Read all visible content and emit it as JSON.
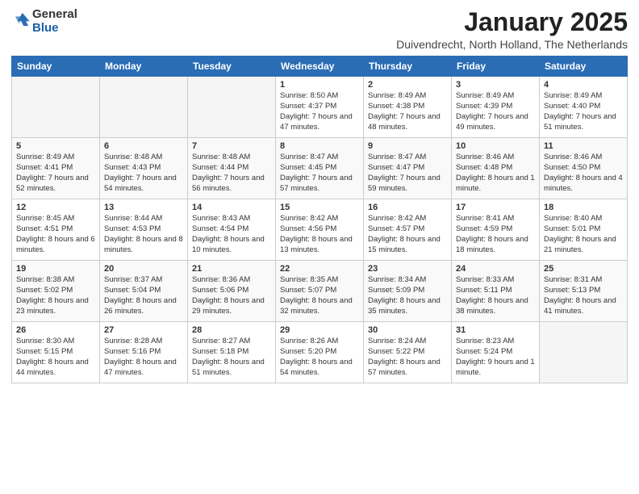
{
  "header": {
    "logo_general": "General",
    "logo_blue": "Blue",
    "month_title": "January 2025",
    "location": "Duivendrecht, North Holland, The Netherlands"
  },
  "weekdays": [
    "Sunday",
    "Monday",
    "Tuesday",
    "Wednesday",
    "Thursday",
    "Friday",
    "Saturday"
  ],
  "weeks": [
    [
      {
        "day": "",
        "info": ""
      },
      {
        "day": "",
        "info": ""
      },
      {
        "day": "",
        "info": ""
      },
      {
        "day": "1",
        "info": "Sunrise: 8:50 AM\nSunset: 4:37 PM\nDaylight: 7 hours and 47 minutes."
      },
      {
        "day": "2",
        "info": "Sunrise: 8:49 AM\nSunset: 4:38 PM\nDaylight: 7 hours and 48 minutes."
      },
      {
        "day": "3",
        "info": "Sunrise: 8:49 AM\nSunset: 4:39 PM\nDaylight: 7 hours and 49 minutes."
      },
      {
        "day": "4",
        "info": "Sunrise: 8:49 AM\nSunset: 4:40 PM\nDaylight: 7 hours and 51 minutes."
      }
    ],
    [
      {
        "day": "5",
        "info": "Sunrise: 8:49 AM\nSunset: 4:41 PM\nDaylight: 7 hours and 52 minutes."
      },
      {
        "day": "6",
        "info": "Sunrise: 8:48 AM\nSunset: 4:43 PM\nDaylight: 7 hours and 54 minutes."
      },
      {
        "day": "7",
        "info": "Sunrise: 8:48 AM\nSunset: 4:44 PM\nDaylight: 7 hours and 56 minutes."
      },
      {
        "day": "8",
        "info": "Sunrise: 8:47 AM\nSunset: 4:45 PM\nDaylight: 7 hours and 57 minutes."
      },
      {
        "day": "9",
        "info": "Sunrise: 8:47 AM\nSunset: 4:47 PM\nDaylight: 7 hours and 59 minutes."
      },
      {
        "day": "10",
        "info": "Sunrise: 8:46 AM\nSunset: 4:48 PM\nDaylight: 8 hours and 1 minute."
      },
      {
        "day": "11",
        "info": "Sunrise: 8:46 AM\nSunset: 4:50 PM\nDaylight: 8 hours and 4 minutes."
      }
    ],
    [
      {
        "day": "12",
        "info": "Sunrise: 8:45 AM\nSunset: 4:51 PM\nDaylight: 8 hours and 6 minutes."
      },
      {
        "day": "13",
        "info": "Sunrise: 8:44 AM\nSunset: 4:53 PM\nDaylight: 8 hours and 8 minutes."
      },
      {
        "day": "14",
        "info": "Sunrise: 8:43 AM\nSunset: 4:54 PM\nDaylight: 8 hours and 10 minutes."
      },
      {
        "day": "15",
        "info": "Sunrise: 8:42 AM\nSunset: 4:56 PM\nDaylight: 8 hours and 13 minutes."
      },
      {
        "day": "16",
        "info": "Sunrise: 8:42 AM\nSunset: 4:57 PM\nDaylight: 8 hours and 15 minutes."
      },
      {
        "day": "17",
        "info": "Sunrise: 8:41 AM\nSunset: 4:59 PM\nDaylight: 8 hours and 18 minutes."
      },
      {
        "day": "18",
        "info": "Sunrise: 8:40 AM\nSunset: 5:01 PM\nDaylight: 8 hours and 21 minutes."
      }
    ],
    [
      {
        "day": "19",
        "info": "Sunrise: 8:38 AM\nSunset: 5:02 PM\nDaylight: 8 hours and 23 minutes."
      },
      {
        "day": "20",
        "info": "Sunrise: 8:37 AM\nSunset: 5:04 PM\nDaylight: 8 hours and 26 minutes."
      },
      {
        "day": "21",
        "info": "Sunrise: 8:36 AM\nSunset: 5:06 PM\nDaylight: 8 hours and 29 minutes."
      },
      {
        "day": "22",
        "info": "Sunrise: 8:35 AM\nSunset: 5:07 PM\nDaylight: 8 hours and 32 minutes."
      },
      {
        "day": "23",
        "info": "Sunrise: 8:34 AM\nSunset: 5:09 PM\nDaylight: 8 hours and 35 minutes."
      },
      {
        "day": "24",
        "info": "Sunrise: 8:33 AM\nSunset: 5:11 PM\nDaylight: 8 hours and 38 minutes."
      },
      {
        "day": "25",
        "info": "Sunrise: 8:31 AM\nSunset: 5:13 PM\nDaylight: 8 hours and 41 minutes."
      }
    ],
    [
      {
        "day": "26",
        "info": "Sunrise: 8:30 AM\nSunset: 5:15 PM\nDaylight: 8 hours and 44 minutes."
      },
      {
        "day": "27",
        "info": "Sunrise: 8:28 AM\nSunset: 5:16 PM\nDaylight: 8 hours and 47 minutes."
      },
      {
        "day": "28",
        "info": "Sunrise: 8:27 AM\nSunset: 5:18 PM\nDaylight: 8 hours and 51 minutes."
      },
      {
        "day": "29",
        "info": "Sunrise: 8:26 AM\nSunset: 5:20 PM\nDaylight: 8 hours and 54 minutes."
      },
      {
        "day": "30",
        "info": "Sunrise: 8:24 AM\nSunset: 5:22 PM\nDaylight: 8 hours and 57 minutes."
      },
      {
        "day": "31",
        "info": "Sunrise: 8:23 AM\nSunset: 5:24 PM\nDaylight: 9 hours and 1 minute."
      },
      {
        "day": "",
        "info": ""
      }
    ]
  ]
}
